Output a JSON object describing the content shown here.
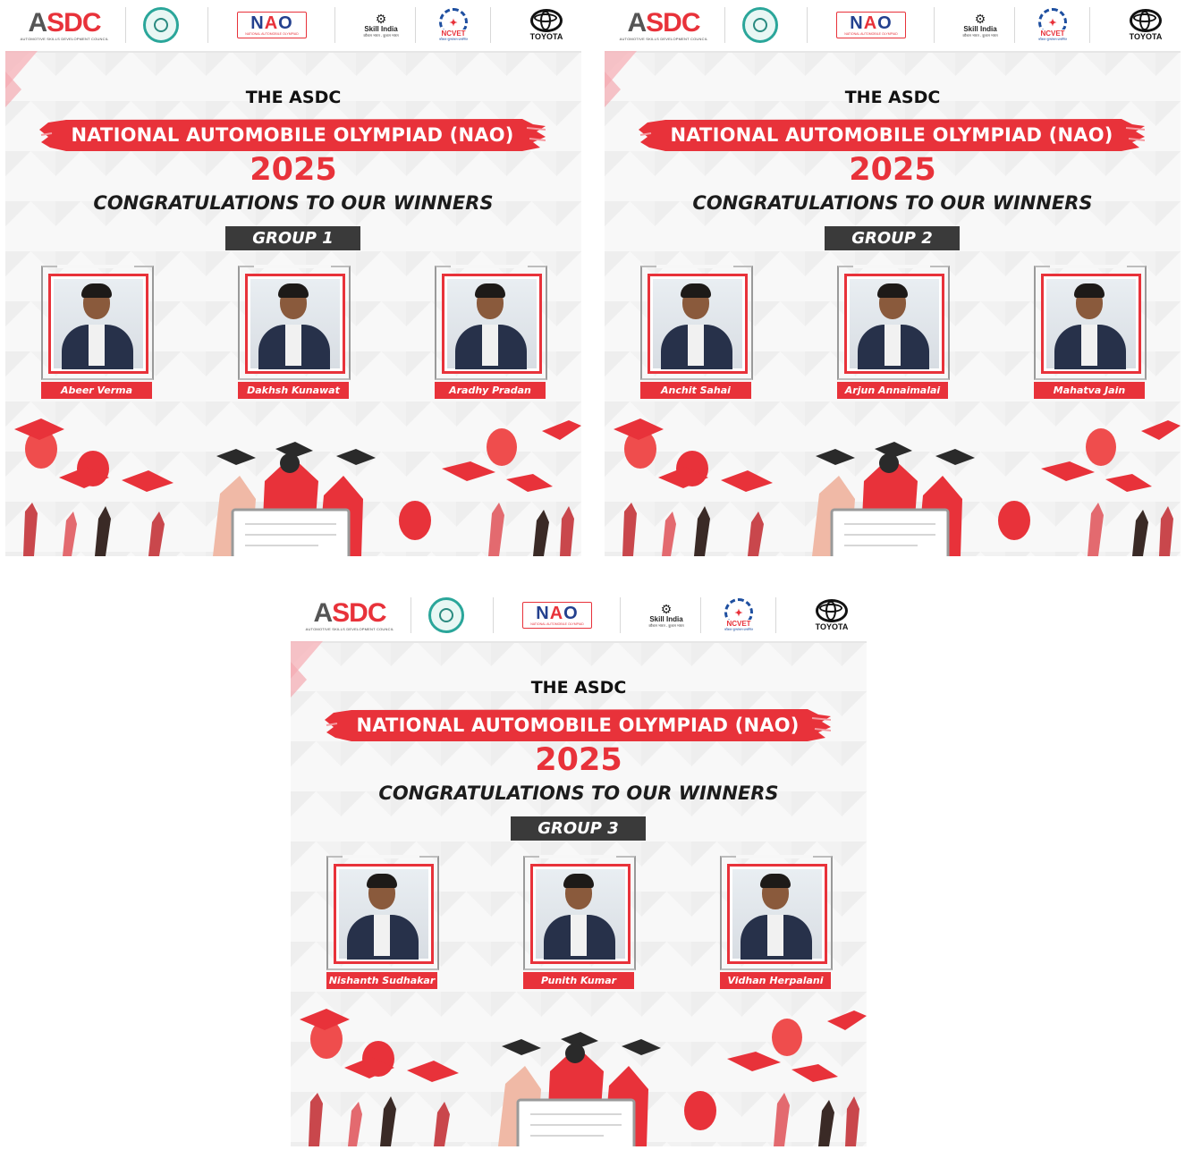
{
  "logos": {
    "asdc": "ASDC",
    "asdc_sub": "AUTOMOTIVE SKILLS DEVELOPMENT COUNCIL",
    "nao": "NAO",
    "nao_sub": "NATIONAL AUTOMOBILE OLYMPIAD",
    "skill_india": "Skill India",
    "skill_india_sub": "कौशल भारत - कुशल भारत",
    "ncvet": "NCVET",
    "ncvet_sub": "कौशल मूल्यांकन प्रमाणित",
    "toyota": "TOYOTA"
  },
  "posters": [
    {
      "pretitle": "THE ASDC",
      "banner": "NATIONAL AUTOMOBILE OLYMPIAD (NAO)",
      "year": "2025",
      "congrats": "CONGRATULATIONS TO OUR WINNERS",
      "group": "GROUP 1",
      "winners": [
        "Abeer Verma",
        "Dakhsh Kunawat",
        "Aradhy Pradan"
      ]
    },
    {
      "pretitle": "THE ASDC",
      "banner": "NATIONAL AUTOMOBILE OLYMPIAD (NAO)",
      "year": "2025",
      "congrats": "CONGRATULATIONS TO OUR WINNERS",
      "group": "GROUP 2",
      "winners": [
        "Anchit Sahai",
        "Arjun Annaimalai",
        "Mahatva Jain"
      ]
    },
    {
      "pretitle": "THE ASDC",
      "banner": "NATIONAL AUTOMOBILE OLYMPIAD (NAO)",
      "year": "2025",
      "congrats": "CONGRATULATIONS TO OUR WINNERS",
      "group": "GROUP 3",
      "winners": [
        "Nishanth Sudhakar",
        "Punith Kumar",
        "Vidhan Herpalani"
      ]
    }
  ],
  "colors": {
    "accent": "#e8323a",
    "group_bg": "#3a3a3a",
    "page_bg": "#ffffff"
  }
}
